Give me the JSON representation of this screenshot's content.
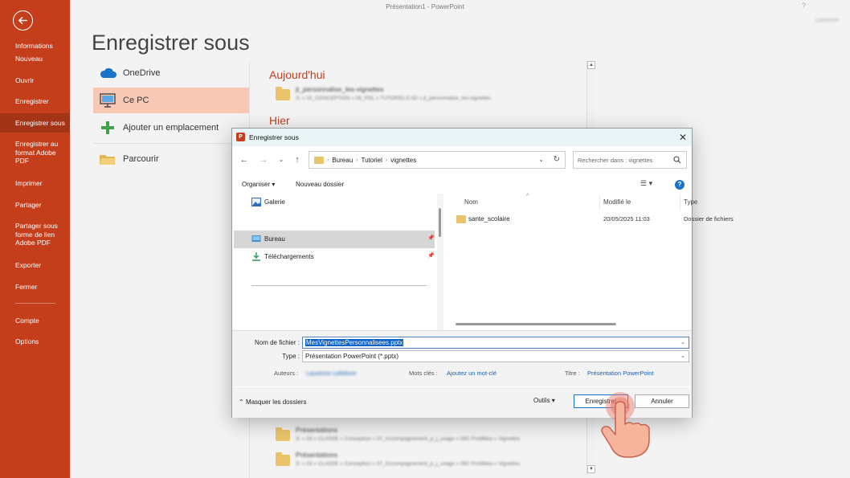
{
  "window": {
    "title": "Présentation1 - PowerPoint",
    "help": "?",
    "account": "Laurence"
  },
  "rail": {
    "items": [
      {
        "label": "Informations"
      },
      {
        "label": "Nouveau"
      },
      {
        "label": "Ouvrir"
      },
      {
        "label": "Enregistrer"
      },
      {
        "label": "Enregistrer sous"
      },
      {
        "label": "Enregistrer au format Adobe PDF"
      },
      {
        "label": "Imprimer"
      },
      {
        "label": "Partager"
      },
      {
        "label": "Partager sous forme de lien Adobe PDF"
      },
      {
        "label": "Exporter"
      },
      {
        "label": "Fermer"
      },
      {
        "label": "Compte"
      },
      {
        "label": "Options"
      }
    ],
    "accent": "#c43e1c"
  },
  "backstage": {
    "heading": "Enregistrer sous",
    "locations": [
      {
        "label": "OneDrive",
        "icon": "cloud-icon"
      },
      {
        "label": "Ce PC",
        "icon": "computer-icon"
      },
      {
        "label": "Ajouter un emplacement",
        "icon": "plus-icon"
      },
      {
        "label": "Parcourir",
        "icon": "folder-open-icon"
      }
    ],
    "recent": {
      "today": "Aujourd'hui",
      "yesterday": "Hier",
      "items": [
        {
          "name": "jt_personnalise_les-vignettes",
          "path": "S: » 02_CONCEPTION » 06_PDL » TUTORIELS AD » jt_personnalise_les-vignettes"
        },
        {
          "name": "Présentations",
          "path": "S: » 03 » CLASSE » Conception » 07_Accompagnement_p_j_usage » 06C Prolifikka » Vignettes"
        },
        {
          "name": "Présentations",
          "path": "S: » 03 » CLASSE » Conception » 07_Accompagnement_p_j_usage » 06C Prolifikka » Vignettes"
        }
      ]
    }
  },
  "dialog": {
    "title": "Enregistrer sous",
    "close": "✕",
    "breadcrumb": [
      "Bureau",
      "Tutoriel",
      "vignettes"
    ],
    "search_placeholder": "Rechercher dans : vignettes",
    "organize": "Organiser",
    "new_folder": "Nouveau dossier",
    "nav_items": [
      {
        "label": "Galerie",
        "icon": "gallery-icon"
      },
      {
        "label": "Bureau",
        "icon": "desktop-icon"
      },
      {
        "label": "Téléchargements",
        "icon": "download-icon"
      }
    ],
    "columns": {
      "name": "Nom",
      "modified": "Modifié le",
      "type": "Type"
    },
    "files": [
      {
        "name": "sante_scolaire",
        "modified": "20/05/2025 11:03",
        "type": "Dossier de fichiers"
      }
    ],
    "filename_label": "Nom de fichier :",
    "filename_value": "MesVignettesPersonnalisees.pptx",
    "type_label": "Type :",
    "type_value": "Présentation PowerPoint (*.pptx)",
    "authors_label": "Auteurs :",
    "authors_value": "Laurence Lefebvre",
    "tags_label": "Mots clés :",
    "tags_value": "Ajoutez un mot-clé",
    "title_label": "Titre :",
    "title_value": "Présentation PowerPoint",
    "hide_folders": "Masquer les dossiers",
    "tools": "Outils",
    "save": "Enregistrer",
    "cancel": "Annuler"
  }
}
